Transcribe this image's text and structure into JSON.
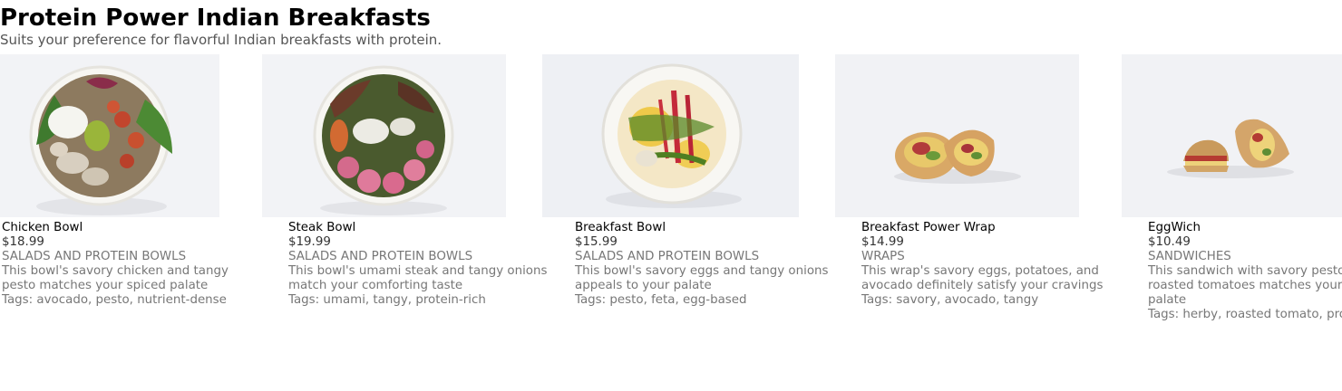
{
  "header": {
    "title": "Protein Power Indian Breakfasts",
    "subtitle": "Suits your preference for flavorful Indian breakfasts with protein."
  },
  "tags_prefix": "Tags: ",
  "items": [
    {
      "name": "Chicken Bowl",
      "price": "$18.99",
      "category": "SALADS AND PROTEIN BOWLS",
      "description": "This bowl's savory chicken and tangy pesto matches your spiced palate",
      "tags": "avocado, pesto, nutrient-dense",
      "image_icon": "chicken-bowl-photo"
    },
    {
      "name": "Steak Bowl",
      "price": "$19.99",
      "category": "SALADS AND PROTEIN BOWLS",
      "description": "This bowl's umami steak and tangy onions match your comforting taste",
      "tags": "umami, tangy, protein-rich",
      "image_icon": "steak-bowl-photo"
    },
    {
      "name": "Breakfast Bowl",
      "price": "$15.99",
      "category": "SALADS AND PROTEIN BOWLS",
      "description": "This bowl's savory eggs and tangy onions appeals to your palate",
      "tags": "pesto, feta, egg-based",
      "image_icon": "breakfast-bowl-photo"
    },
    {
      "name": "Breakfast Power Wrap",
      "price": "$14.99",
      "category": "WRAPS",
      "description": "This wrap's savory eggs, potatoes, and avocado definitely satisfy your cravings",
      "tags": "savory, avocado, tangy",
      "image_icon": "wrap-photo"
    },
    {
      "name": "EggWich",
      "price": "$10.49",
      "category": "SANDWICHES",
      "description": "This sandwich with savory pesto and roasted tomatoes matches your palate",
      "tags": "herby, roasted tomato, protein",
      "image_icon": "sandwich-photo"
    }
  ]
}
